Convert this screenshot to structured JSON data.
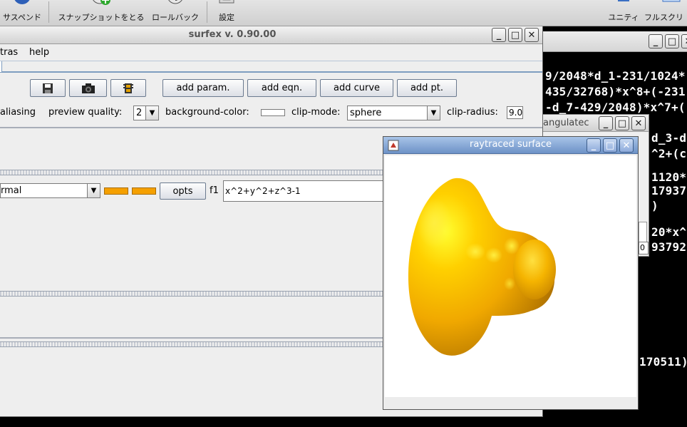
{
  "top_toolbar": {
    "items": [
      {
        "label": "サスペンド",
        "icon": "pause-icon"
      },
      {
        "label": "スナップショットをとる",
        "icon": "snapshot-add-icon"
      },
      {
        "label": "ロールバック",
        "icon": "rollback-icon"
      },
      {
        "label": "設定",
        "icon": "settings-icon"
      },
      {
        "label": "ユニティ",
        "icon": "unity-icon"
      },
      {
        "label": "フルスクリ",
        "icon": "fullscreen-icon"
      }
    ]
  },
  "main_window": {
    "title": "surfex v. 0.90.00",
    "controls": [
      "_",
      "□",
      "✕"
    ],
    "menu": [
      "tras",
      "help"
    ],
    "toolbar": {
      "icon_buttons": [
        "save-icon",
        "camera-icon",
        "movie-icon"
      ],
      "add_param": "add param.",
      "add_eqn": "add eqn.",
      "add_curve": "add curve",
      "add_pt": "add pt."
    },
    "options": {
      "antialiasing_label": "aliasing",
      "preview_quality_label": "preview quality:",
      "preview_quality_value": "2",
      "background_color_label": "background-color:",
      "clip_mode_label": "clip-mode:",
      "clip_mode_value": "sphere",
      "clip_radius_label": "clip-radius:",
      "clip_radius_value": "9.0"
    },
    "equation": {
      "mode_value": "rmal",
      "opts_label": "opts",
      "name": "f1",
      "value": "x^2+y^2+z^3-1",
      "colors": [
        "#f5a000",
        "#f5a000"
      ]
    }
  },
  "terminal": {
    "lines": [
      "9/2048*d_1-231/1024*",
      "435/32768)*x^8+(-231",
      "-d_7-429/2048)*x^7+(",
      "",
      "",
      "",
      "",
      "",
      "",
      "",
      "",
      "",
      "",
      "",
      "",
      "",
      "",
      "",
      "",
      "",
      "",
      "",
      "",
      "170511)"
    ],
    "right_fragments": [
      "d_3-d",
      "^2+(c",
      "1120*",
      "17937",
      ")",
      "20*x^",
      "93792"
    ]
  },
  "angulated_window": {
    "title": "angulatec",
    "field_value": "0"
  },
  "ray_window": {
    "title": "raytraced surface",
    "surface_color": "#f5b800"
  }
}
